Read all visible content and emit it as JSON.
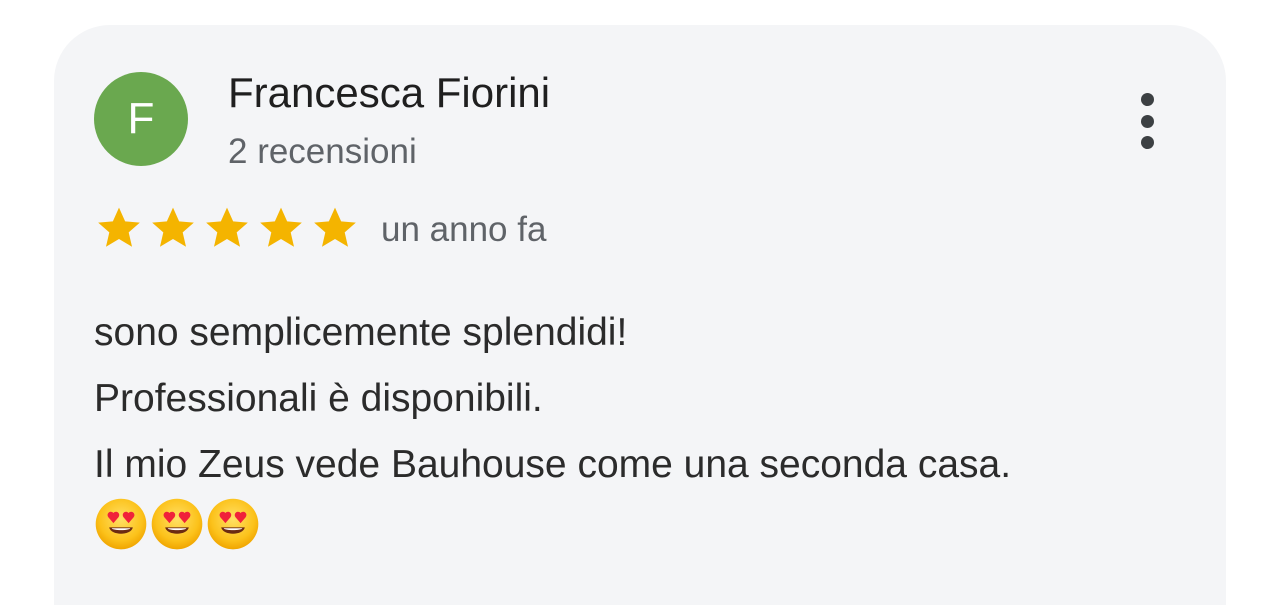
{
  "review": {
    "author": {
      "initial": "F",
      "name": "Francesca Fiorini",
      "review_count": "2 recensioni",
      "avatar_color": "#6aa84f"
    },
    "rating": 5,
    "max_rating": 5,
    "time_ago": "un anno fa",
    "text_lines": [
      "sono semplicemente splendidi!",
      "Professionali è disponibili.",
      "Il mio Zeus vede Bauhouse come una seconda casa."
    ],
    "emojis": [
      "smiling-face-with-heart-eyes",
      "smiling-face-with-heart-eyes",
      "smiling-face-with-heart-eyes"
    ]
  },
  "colors": {
    "star": "#f4b400",
    "card_background": "#f4f5f7"
  }
}
